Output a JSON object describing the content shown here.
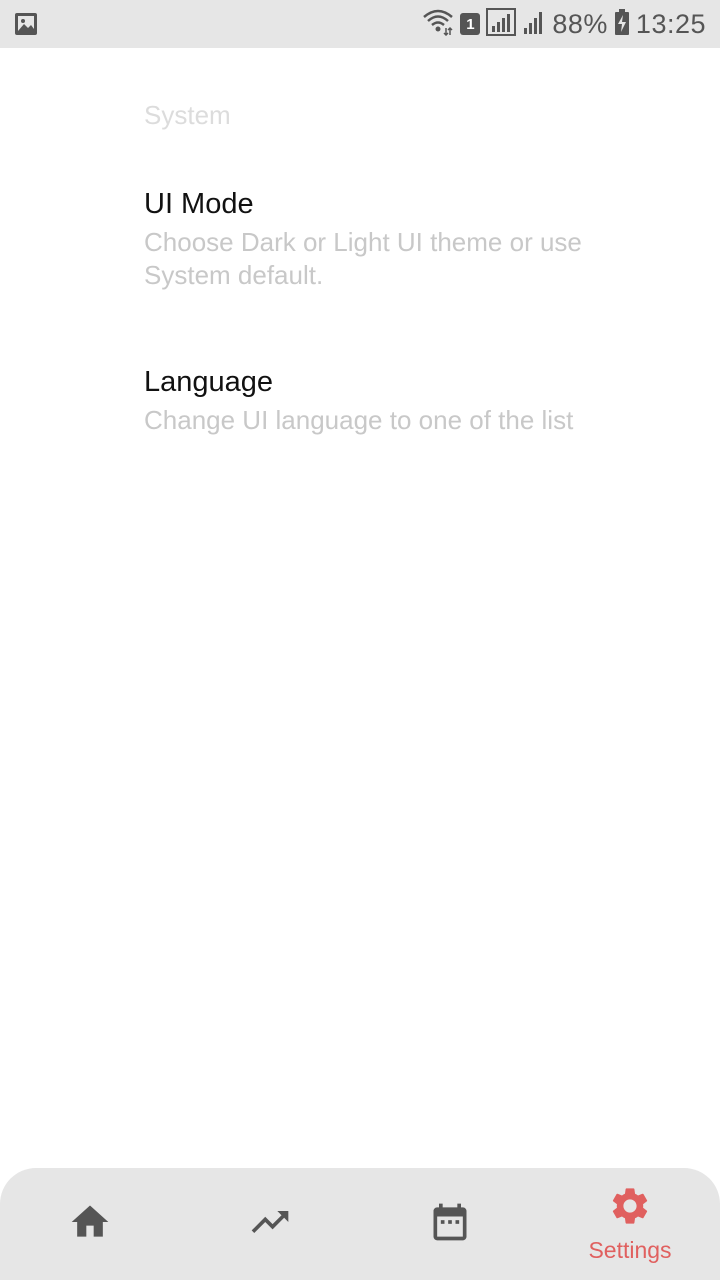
{
  "status_bar": {
    "battery": "88%",
    "time": "13:25",
    "sim_badge": "1"
  },
  "settings": {
    "section_header": "System",
    "items": [
      {
        "title": "UI Mode",
        "summary": "Choose Dark or Light UI theme or use System default."
      },
      {
        "title": "Language",
        "summary": "Change UI language to one of the list"
      }
    ]
  },
  "bottom_nav": {
    "items": [
      {
        "icon": "home-icon",
        "label": "",
        "selected": false
      },
      {
        "icon": "trending-up-icon",
        "label": "",
        "selected": false
      },
      {
        "icon": "calendar-icon",
        "label": "",
        "selected": false
      },
      {
        "icon": "gear-icon",
        "label": "Settings",
        "selected": true
      }
    ]
  },
  "colors": {
    "accent": "#e0605f",
    "icon_inactive": "#555555",
    "nav_background": "#e6e6e6",
    "summary_text": "#c8c8c8",
    "header_text": "#dcdcdc"
  }
}
